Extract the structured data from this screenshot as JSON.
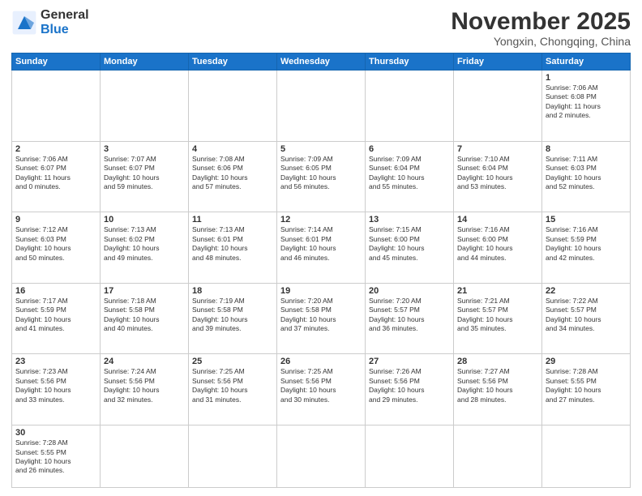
{
  "header": {
    "logo_general": "General",
    "logo_blue": "Blue",
    "main_title": "November 2025",
    "sub_title": "Yongxin, Chongqing, China"
  },
  "weekdays": [
    "Sunday",
    "Monday",
    "Tuesday",
    "Wednesday",
    "Thursday",
    "Friday",
    "Saturday"
  ],
  "weeks": [
    [
      {
        "day": "",
        "info": ""
      },
      {
        "day": "",
        "info": ""
      },
      {
        "day": "",
        "info": ""
      },
      {
        "day": "",
        "info": ""
      },
      {
        "day": "",
        "info": ""
      },
      {
        "day": "",
        "info": ""
      },
      {
        "day": "1",
        "info": "Sunrise: 7:06 AM\nSunset: 6:08 PM\nDaylight: 11 hours\nand 2 minutes."
      }
    ],
    [
      {
        "day": "2",
        "info": "Sunrise: 7:06 AM\nSunset: 6:07 PM\nDaylight: 11 hours\nand 0 minutes."
      },
      {
        "day": "3",
        "info": "Sunrise: 7:07 AM\nSunset: 6:07 PM\nDaylight: 10 hours\nand 59 minutes."
      },
      {
        "day": "4",
        "info": "Sunrise: 7:08 AM\nSunset: 6:06 PM\nDaylight: 10 hours\nand 57 minutes."
      },
      {
        "day": "5",
        "info": "Sunrise: 7:09 AM\nSunset: 6:05 PM\nDaylight: 10 hours\nand 56 minutes."
      },
      {
        "day": "6",
        "info": "Sunrise: 7:09 AM\nSunset: 6:04 PM\nDaylight: 10 hours\nand 55 minutes."
      },
      {
        "day": "7",
        "info": "Sunrise: 7:10 AM\nSunset: 6:04 PM\nDaylight: 10 hours\nand 53 minutes."
      },
      {
        "day": "8",
        "info": "Sunrise: 7:11 AM\nSunset: 6:03 PM\nDaylight: 10 hours\nand 52 minutes."
      }
    ],
    [
      {
        "day": "9",
        "info": "Sunrise: 7:12 AM\nSunset: 6:03 PM\nDaylight: 10 hours\nand 50 minutes."
      },
      {
        "day": "10",
        "info": "Sunrise: 7:13 AM\nSunset: 6:02 PM\nDaylight: 10 hours\nand 49 minutes."
      },
      {
        "day": "11",
        "info": "Sunrise: 7:13 AM\nSunset: 6:01 PM\nDaylight: 10 hours\nand 48 minutes."
      },
      {
        "day": "12",
        "info": "Sunrise: 7:14 AM\nSunset: 6:01 PM\nDaylight: 10 hours\nand 46 minutes."
      },
      {
        "day": "13",
        "info": "Sunrise: 7:15 AM\nSunset: 6:00 PM\nDaylight: 10 hours\nand 45 minutes."
      },
      {
        "day": "14",
        "info": "Sunrise: 7:16 AM\nSunset: 6:00 PM\nDaylight: 10 hours\nand 44 minutes."
      },
      {
        "day": "15",
        "info": "Sunrise: 7:16 AM\nSunset: 5:59 PM\nDaylight: 10 hours\nand 42 minutes."
      }
    ],
    [
      {
        "day": "16",
        "info": "Sunrise: 7:17 AM\nSunset: 5:59 PM\nDaylight: 10 hours\nand 41 minutes."
      },
      {
        "day": "17",
        "info": "Sunrise: 7:18 AM\nSunset: 5:58 PM\nDaylight: 10 hours\nand 40 minutes."
      },
      {
        "day": "18",
        "info": "Sunrise: 7:19 AM\nSunset: 5:58 PM\nDaylight: 10 hours\nand 39 minutes."
      },
      {
        "day": "19",
        "info": "Sunrise: 7:20 AM\nSunset: 5:58 PM\nDaylight: 10 hours\nand 37 minutes."
      },
      {
        "day": "20",
        "info": "Sunrise: 7:20 AM\nSunset: 5:57 PM\nDaylight: 10 hours\nand 36 minutes."
      },
      {
        "day": "21",
        "info": "Sunrise: 7:21 AM\nSunset: 5:57 PM\nDaylight: 10 hours\nand 35 minutes."
      },
      {
        "day": "22",
        "info": "Sunrise: 7:22 AM\nSunset: 5:57 PM\nDaylight: 10 hours\nand 34 minutes."
      }
    ],
    [
      {
        "day": "23",
        "info": "Sunrise: 7:23 AM\nSunset: 5:56 PM\nDaylight: 10 hours\nand 33 minutes."
      },
      {
        "day": "24",
        "info": "Sunrise: 7:24 AM\nSunset: 5:56 PM\nDaylight: 10 hours\nand 32 minutes."
      },
      {
        "day": "25",
        "info": "Sunrise: 7:25 AM\nSunset: 5:56 PM\nDaylight: 10 hours\nand 31 minutes."
      },
      {
        "day": "26",
        "info": "Sunrise: 7:25 AM\nSunset: 5:56 PM\nDaylight: 10 hours\nand 30 minutes."
      },
      {
        "day": "27",
        "info": "Sunrise: 7:26 AM\nSunset: 5:56 PM\nDaylight: 10 hours\nand 29 minutes."
      },
      {
        "day": "28",
        "info": "Sunrise: 7:27 AM\nSunset: 5:56 PM\nDaylight: 10 hours\nand 28 minutes."
      },
      {
        "day": "29",
        "info": "Sunrise: 7:28 AM\nSunset: 5:55 PM\nDaylight: 10 hours\nand 27 minutes."
      }
    ],
    [
      {
        "day": "30",
        "info": "Sunrise: 7:28 AM\nSunset: 5:55 PM\nDaylight: 10 hours\nand 26 minutes."
      },
      {
        "day": "",
        "info": ""
      },
      {
        "day": "",
        "info": ""
      },
      {
        "day": "",
        "info": ""
      },
      {
        "day": "",
        "info": ""
      },
      {
        "day": "",
        "info": ""
      },
      {
        "day": "",
        "info": ""
      }
    ]
  ]
}
